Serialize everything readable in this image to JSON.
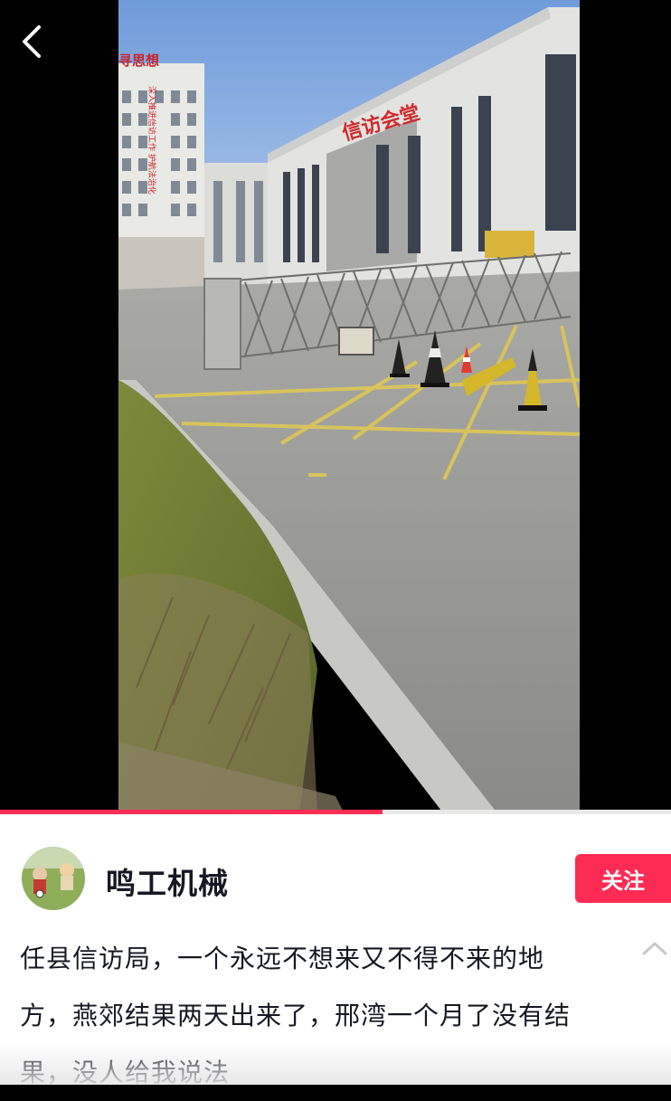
{
  "video": {
    "progress_fraction": 0.57,
    "building_sign": "信访会堂",
    "rooftop_sign": "寻思想",
    "facade_banner": "深入推进信访工作 护航法治化"
  },
  "author": {
    "name": "鸣工机械",
    "follow_label": "关注"
  },
  "caption": {
    "lines": [
      "任县信访局，一个永远不想来又不得不来的地",
      "方，燕郊结果两天出来了，邢湾一个月了没有结",
      "果，没人给我说法"
    ]
  },
  "icons": {
    "back": "chevron-left-icon",
    "collapse": "chevron-up-icon"
  },
  "colors": {
    "accent": "#fe2c55",
    "text": "#161823",
    "chevron": "#c8c8c8"
  }
}
